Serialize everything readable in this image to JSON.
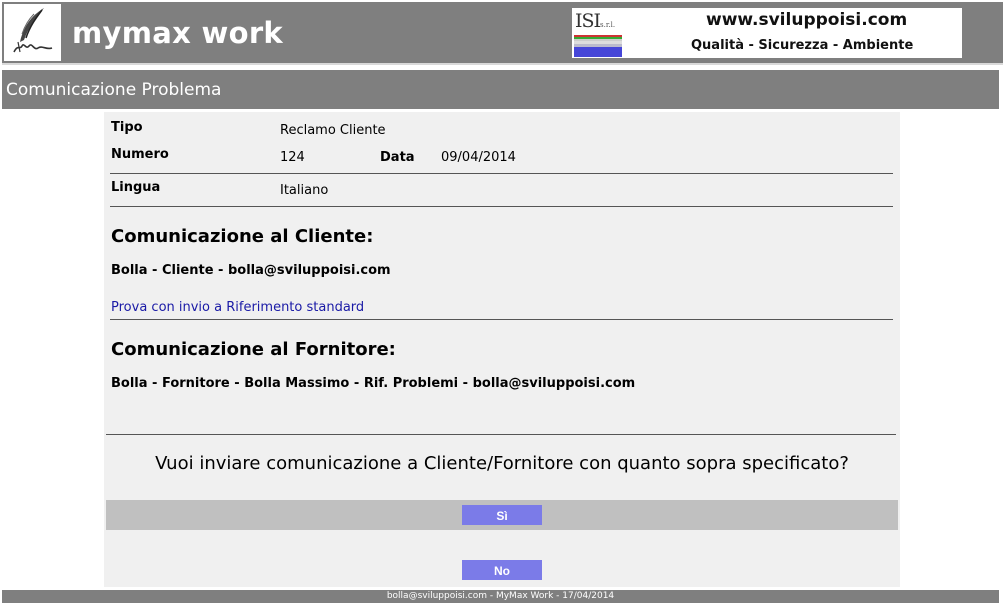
{
  "header": {
    "app_title": "mymax work",
    "banner": {
      "isl_text": "ISI",
      "isl_small": "s.r.l.",
      "website": "www.sviluppoisi.com",
      "tagline": "Qualità - Sicurezza - Ambiente"
    }
  },
  "section": {
    "title": "Comunicazione Problema"
  },
  "form": {
    "tipo_label": "Tipo",
    "tipo_value": "Reclamo Cliente",
    "numero_label": "Numero",
    "numero_value": "124",
    "data_label": "Data",
    "data_value": "09/04/2014",
    "lingua_label": "Lingua",
    "lingua_value": "Italiano"
  },
  "cliente": {
    "heading": "Comunicazione al Cliente:",
    "recipient": "Bolla - Cliente - bolla@sviluppoisi.com",
    "reference_link": "Prova con invio a Riferimento standard"
  },
  "fornitore": {
    "heading": "Comunicazione al Fornitore:",
    "recipient": "Bolla - Fornitore - Bolla Massimo - Rif. Problemi - bolla@sviluppoisi.com"
  },
  "confirm": {
    "question": "Vuoi inviare comunicazione a Cliente/Fornitore con quanto sopra specificato?",
    "yes_label": "Sì",
    "no_label": "No"
  },
  "footer": {
    "text": "bolla@sviluppoisi.com - MyMax Work - 17/04/2014"
  },
  "colors": {
    "header_bg": "#7f7f7f",
    "panel_bg": "#f0f0f0",
    "button_bg": "#7b7be8",
    "link": "#1a1aa6"
  }
}
